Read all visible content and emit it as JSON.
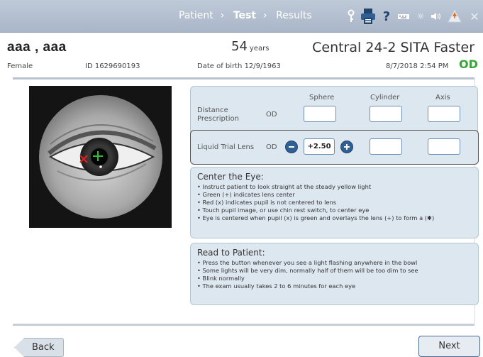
{
  "nav": {
    "crumbs": [
      "Patient",
      "Test",
      "Results"
    ],
    "active": "Test",
    "icons": [
      "key-icon",
      "printer-icon",
      "help-icon",
      "keyboard-icon",
      "brightness-icon",
      "volume-icon",
      "warning-icon",
      "close-icon"
    ]
  },
  "patient": {
    "name": "aaa , aaa",
    "sex": "Female",
    "id_text": "ID 1629690193",
    "age": "54",
    "age_unit": "years",
    "dob_text": "Date of birth  12/9/1963"
  },
  "test": {
    "name": "Central 24-2   SITA Faster",
    "datetime": "8/7/2018 2:54 PM",
    "eye": "OD"
  },
  "prescription": {
    "headers": {
      "sphere": "Sphere",
      "cylinder": "Cylinder",
      "axis": "Axis"
    },
    "distance_label": "Distance Prescription",
    "distance_eye": "OD",
    "trial_label": "Liquid Trial Lens",
    "trial_eye": "OD",
    "trial_sphere": "+2.50"
  },
  "center_eye": {
    "title": "Center the Eye:",
    "items": [
      "• Instruct patient to look straight at the steady yellow light",
      "• Green (+) indicates lens center",
      "• Red (x) indicates pupil is not centered to lens",
      "• Touch pupil image, or use chin rest switch, to center eye",
      "• Eye is centered when pupil (x) is green and overlays the lens (+) to form a (✱)"
    ]
  },
  "read_patient": {
    "title": "Read to Patient:",
    "items": [
      "• Press the button whenever you see a light flashing anywhere in the bowl",
      "• Some lights will be very dim, normally half of them will be too dim to see",
      "• Blink normally",
      "• The exam usually takes 2 to 6 minutes for each eye"
    ]
  },
  "footer": {
    "back": "Back",
    "next": "Next"
  },
  "colors": {
    "accent": "#2f5f93",
    "eye_ok": "#3aa43a",
    "panel": "#dde7ef",
    "warning": "#e07020"
  }
}
